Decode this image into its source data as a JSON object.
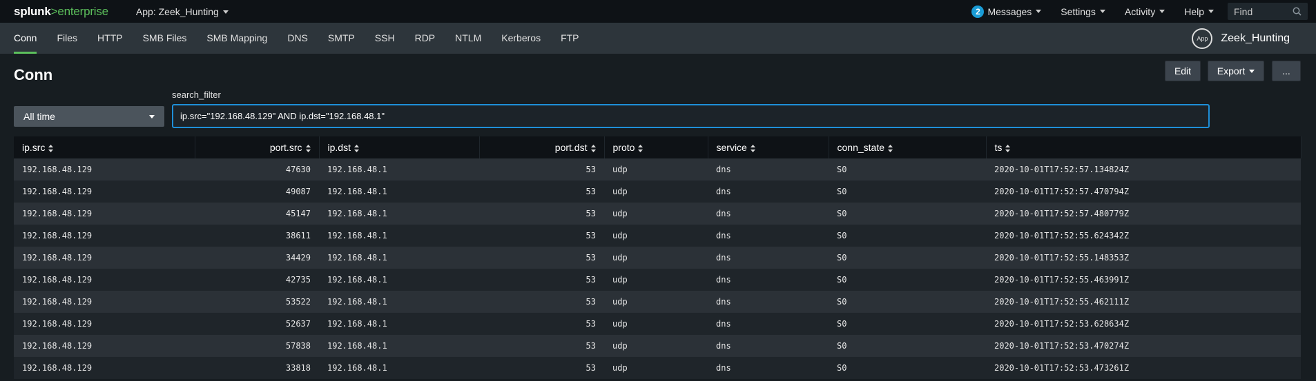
{
  "topbar": {
    "logo_brand": "splunk",
    "logo_product": ">enterprise",
    "app_menu": "App: Zeek_Hunting",
    "messages_count": "2",
    "messages_label": "Messages",
    "settings_label": "Settings",
    "activity_label": "Activity",
    "help_label": "Help",
    "find_placeholder": "Find"
  },
  "nav": {
    "tabs": [
      {
        "label": "Conn",
        "active": true
      },
      {
        "label": "Files"
      },
      {
        "label": "HTTP"
      },
      {
        "label": "SMB Files"
      },
      {
        "label": "SMB Mapping"
      },
      {
        "label": "DNS"
      },
      {
        "label": "SMTP"
      },
      {
        "label": "SSH"
      },
      {
        "label": "RDP"
      },
      {
        "label": "NTLM"
      },
      {
        "label": "Kerberos"
      },
      {
        "label": "FTP"
      }
    ],
    "app_icon_label": "App",
    "app_name": "Zeek_Hunting"
  },
  "page": {
    "title": "Conn",
    "edit_label": "Edit",
    "export_label": "Export",
    "more_label": "...",
    "filter_label": "search_filter",
    "time_range": "All time",
    "search_value": "ip.src=\"192.168.48.129\" AND ip.dst=\"192.168.48.1\""
  },
  "table": {
    "columns": [
      "ip.src",
      "port.src",
      "ip.dst",
      "port.dst",
      "proto",
      "service",
      "conn_state",
      "ts"
    ],
    "rows": [
      [
        "192.168.48.129",
        "47630",
        "192.168.48.1",
        "53",
        "udp",
        "dns",
        "S0",
        "2020-10-01T17:52:57.134824Z"
      ],
      [
        "192.168.48.129",
        "49087",
        "192.168.48.1",
        "53",
        "udp",
        "dns",
        "S0",
        "2020-10-01T17:52:57.470794Z"
      ],
      [
        "192.168.48.129",
        "45147",
        "192.168.48.1",
        "53",
        "udp",
        "dns",
        "S0",
        "2020-10-01T17:52:57.480779Z"
      ],
      [
        "192.168.48.129",
        "38611",
        "192.168.48.1",
        "53",
        "udp",
        "dns",
        "S0",
        "2020-10-01T17:52:55.624342Z"
      ],
      [
        "192.168.48.129",
        "34429",
        "192.168.48.1",
        "53",
        "udp",
        "dns",
        "S0",
        "2020-10-01T17:52:55.148353Z"
      ],
      [
        "192.168.48.129",
        "42735",
        "192.168.48.1",
        "53",
        "udp",
        "dns",
        "S0",
        "2020-10-01T17:52:55.463991Z"
      ],
      [
        "192.168.48.129",
        "53522",
        "192.168.48.1",
        "53",
        "udp",
        "dns",
        "S0",
        "2020-10-01T17:52:55.462111Z"
      ],
      [
        "192.168.48.129",
        "52637",
        "192.168.48.1",
        "53",
        "udp",
        "dns",
        "S0",
        "2020-10-01T17:52:53.628634Z"
      ],
      [
        "192.168.48.129",
        "57838",
        "192.168.48.1",
        "53",
        "udp",
        "dns",
        "S0",
        "2020-10-01T17:52:53.470274Z"
      ],
      [
        "192.168.48.129",
        "33818",
        "192.168.48.1",
        "53",
        "udp",
        "dns",
        "S0",
        "2020-10-01T17:52:53.473261Z"
      ]
    ]
  },
  "colors": {
    "accent_green": "#5cc05c",
    "focus_blue": "#1e8fd8",
    "badge_blue": "#1a9cd6"
  }
}
